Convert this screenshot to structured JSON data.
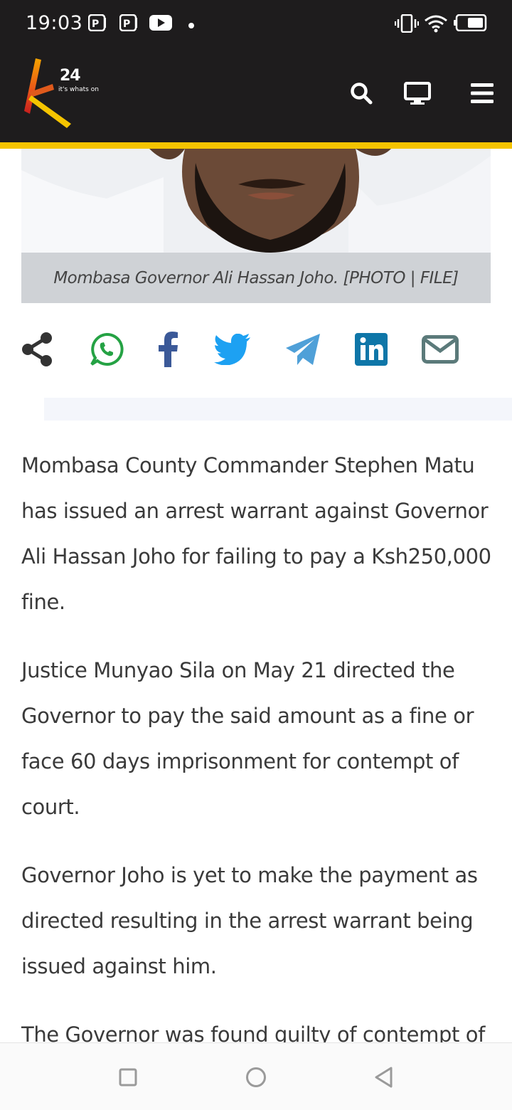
{
  "status_bar": {
    "time": "19:03",
    "left_icons": [
      "pdf-app-icon",
      "pdf-app-icon",
      "youtube-icon",
      "notification-dot-icon"
    ],
    "right_icons": [
      "vibrate-icon",
      "wifi-icon",
      "battery-icon"
    ]
  },
  "header": {
    "logo_text": "K24",
    "logo_number": "24",
    "logo_tagline": "it's whats on",
    "actions": [
      "search-icon",
      "tv-icon",
      "menu-icon"
    ],
    "colors": {
      "background": "#1e1c1d",
      "stripe": "#f5c400"
    }
  },
  "hero": {
    "caption": "Mombasa Governor Ali Hassan Joho. [PHOTO | FILE]"
  },
  "share": {
    "buttons": [
      "share-icon",
      "whatsapp-icon",
      "facebook-icon",
      "twitter-icon",
      "telegram-icon",
      "linkedin-icon",
      "email-icon"
    ],
    "colors": {
      "share": "#333333",
      "whatsapp": "#25a244",
      "facebook": "#3b5998",
      "twitter": "#1da1f2",
      "telegram": "#4fa0d8",
      "linkedin": "#0e76a8",
      "email": "#5b7a7a"
    }
  },
  "article": {
    "paragraphs": [
      "Mombasa County Commander Stephen Matu has issued an arrest warrant against Governor Ali Hassan Joho for failing to pay a Ksh250,000 fine.",
      "Justice Munyao Sila on May 21 directed the Governor to pay the said amount as a fine or face 60 days imprisonment for contempt of court.",
      "Governor Joho is yet to make the payment as directed resulting in the arrest warrant being issued against him.",
      "The Governor was found guilty of contempt of"
    ]
  },
  "nav_bar": {
    "buttons": [
      "recents-icon",
      "home-icon",
      "back-icon"
    ]
  }
}
